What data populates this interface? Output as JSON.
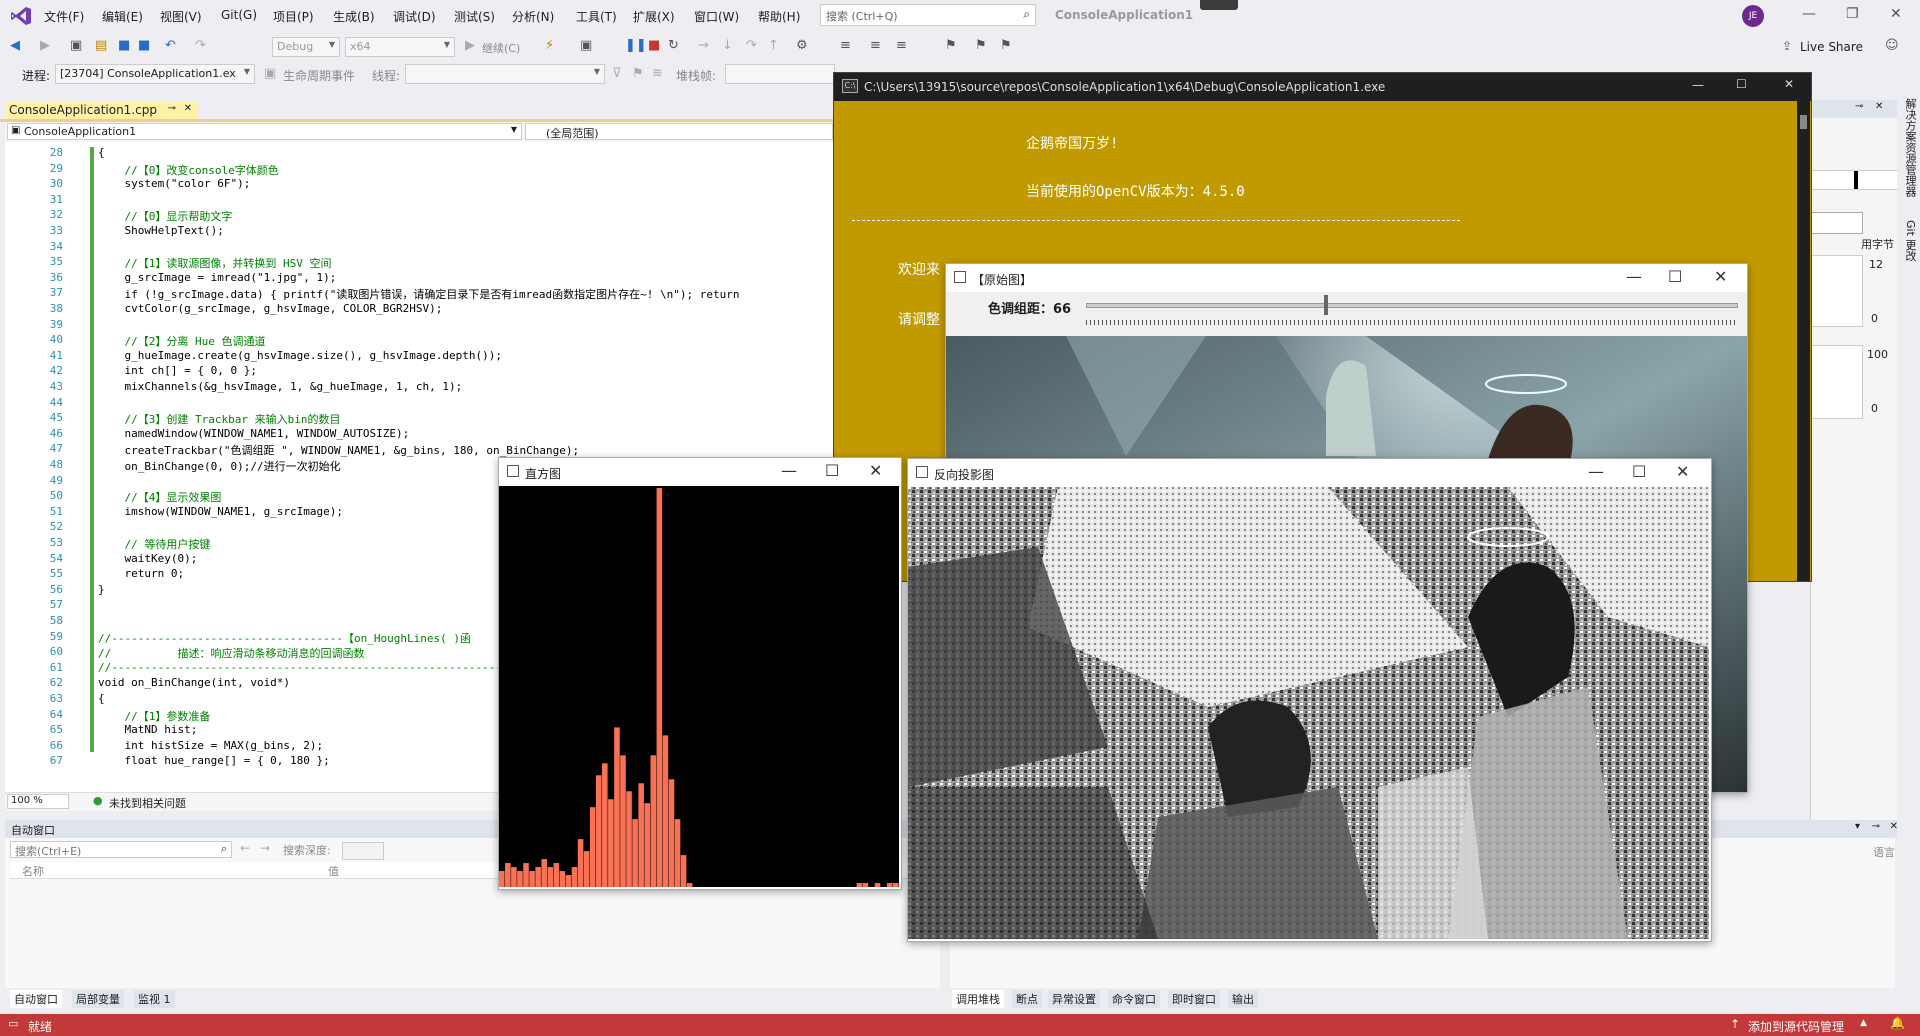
{
  "menu": [
    "文件(F)",
    "编辑(E)",
    "视图(V)",
    "Git(G)",
    "项目(P)",
    "生成(B)",
    "调试(D)",
    "测试(S)",
    "分析(N)",
    "工具(T)",
    "扩展(X)",
    "窗口(W)",
    "帮助(H)"
  ],
  "search": {
    "placeholder": "搜索 (Ctrl+Q)"
  },
  "solution_title": "ConsoleApplication1",
  "avatar_initials": "JE",
  "toolbar": {
    "config": "Debug",
    "platform": "x64",
    "continue_label": "继续(C)",
    "live_share": "Live Share",
    "process_label": "进程:",
    "process_value": "[23704] ConsoleApplication1.ex",
    "lifecycle_label": "生命周期事件",
    "thread_label": "线程:",
    "stackframe_label": "堆栈帧:"
  },
  "editor": {
    "tab_label": "ConsoleApplication1.cpp",
    "project_scope": "ConsoleApplication1",
    "member_scope": "(全局范围)",
    "zoom": "100 %",
    "issues": "未找到相关问题",
    "lines": [
      {
        "n": "28",
        "text": "{"
      },
      {
        "n": "29",
        "text": "    //【0】改变console字体颜色"
      },
      {
        "n": "30",
        "text": "    system(\"color 6F\");"
      },
      {
        "n": "31",
        "text": ""
      },
      {
        "n": "32",
        "text": "    //【0】显示帮助文字"
      },
      {
        "n": "33",
        "text": "    ShowHelpText();"
      },
      {
        "n": "34",
        "text": ""
      },
      {
        "n": "35",
        "text": "    //【1】读取源图像，并转换到 HSV 空间"
      },
      {
        "n": "36",
        "text": "    g_srcImage = imread(\"1.jpg\", 1);"
      },
      {
        "n": "37",
        "text": "    if (!g_srcImage.data) { printf(\"读取图片错误，请确定目录下是否有imread函数指定图片存在~! \\n\"); return"
      },
      {
        "n": "38",
        "text": "    cvtColor(g_srcImage, g_hsvImage, COLOR_BGR2HSV);"
      },
      {
        "n": "39",
        "text": ""
      },
      {
        "n": "40",
        "text": "    //【2】分离 Hue 色调通道"
      },
      {
        "n": "41",
        "text": "    g_hueImage.create(g_hsvImage.size(), g_hsvImage.depth());"
      },
      {
        "n": "42",
        "text": "    int ch[] = { 0, 0 };"
      },
      {
        "n": "43",
        "text": "    mixChannels(&g_hsvImage, 1, &g_hueImage, 1, ch, 1);"
      },
      {
        "n": "44",
        "text": ""
      },
      {
        "n": "45",
        "text": "    //【3】创建 Trackbar 来输入bin的数目"
      },
      {
        "n": "46",
        "text": "    namedWindow(WINDOW_NAME1, WINDOW_AUTOSIZE);"
      },
      {
        "n": "47",
        "text": "    createTrackbar(\"色调组距 \", WINDOW_NAME1, &g_bins, 180, on_BinChange);"
      },
      {
        "n": "48",
        "text": "    on_BinChange(0, 0);//进行一次初始化"
      },
      {
        "n": "49",
        "text": ""
      },
      {
        "n": "50",
        "text": "    //【4】显示效果图"
      },
      {
        "n": "51",
        "text": "    imshow(WINDOW_NAME1, g_srcImage);"
      },
      {
        "n": "52",
        "text": ""
      },
      {
        "n": "53",
        "text": "    // 等待用户按键"
      },
      {
        "n": "54",
        "text": "    waitKey(0);"
      },
      {
        "n": "55",
        "text": "    return 0;"
      },
      {
        "n": "56",
        "text": "}"
      },
      {
        "n": "57",
        "text": ""
      },
      {
        "n": "58",
        "text": ""
      },
      {
        "n": "59",
        "text": "//-----------------------------------【on_HoughLines( )函"
      },
      {
        "n": "60",
        "text": "//          描述：响应滑动条移动消息的回调函数"
      },
      {
        "n": "61",
        "text": "//---------------------------------------------------------------"
      },
      {
        "n": "62",
        "text": "void on_BinChange(int, void*)"
      },
      {
        "n": "63",
        "text": "{"
      },
      {
        "n": "64",
        "text": "    //【1】参数准备"
      },
      {
        "n": "65",
        "text": "    MatND hist;"
      },
      {
        "n": "66",
        "text": "    int histSize = MAX(g_bins, 2);"
      },
      {
        "n": "67",
        "text": "    float hue_range[] = { 0, 180 };"
      }
    ]
  },
  "auto_window": {
    "title": "自动窗口",
    "search_placeholder": "搜索(Ctrl+E)",
    "search_depth": "搜索深度:",
    "col_name": "名称",
    "col_value": "值",
    "col_lang": "语言"
  },
  "bottom_tabs_left": [
    "自动窗口",
    "局部变量",
    "监视 1"
  ],
  "bottom_tabs_right": [
    "调用堆栈",
    "断点",
    "异常设置",
    "命令窗口",
    "即时窗口",
    "输出"
  ],
  "status": {
    "ready": "就绪",
    "source_control": "添加到源代码管理"
  },
  "side_panel": {
    "solution_explorer": "解决方案资源管理器",
    "git_changes": "Git 更改",
    "bytes_label": "用字节",
    "val1": "12",
    "val2": "0",
    "val3": "100",
    "val4": "0"
  },
  "console": {
    "title": "C:\\Users\\13915\\source\\repos\\ConsoleApplication1\\x64\\Debug\\ConsoleApplication1.exe",
    "line1": "企鹅帝国万岁!",
    "line2": "当前使用的OpenCV版本为：4.5.0",
    "line3": "欢迎来",
    "line4": "请调整",
    "bg_color": "#c19a00"
  },
  "src_window": {
    "title": "【原始图】",
    "trackbar_label": "色调组距：66",
    "trackbar_value": 66,
    "trackbar_max": 180
  },
  "hist_window": {
    "title": "直方图"
  },
  "backproj_window": {
    "title": "反向投影图"
  },
  "chart_data": {
    "type": "bar",
    "title": "",
    "bar_color": "#fa7256",
    "background": "#000000",
    "values": [
      4,
      6,
      5,
      4,
      6,
      4,
      5,
      7,
      5,
      6,
      4,
      3,
      5,
      12,
      9,
      20,
      28,
      31,
      22,
      40,
      33,
      24,
      17,
      26,
      21,
      33,
      100,
      38,
      27,
      17,
      8,
      1,
      0,
      0,
      0,
      0,
      0,
      0,
      0,
      0,
      0,
      0,
      0,
      0,
      0,
      0,
      0,
      0,
      0,
      0,
      0,
      0,
      0,
      0,
      0,
      0,
      0,
      0,
      0,
      1,
      1,
      0,
      1,
      0,
      1,
      1
    ]
  }
}
